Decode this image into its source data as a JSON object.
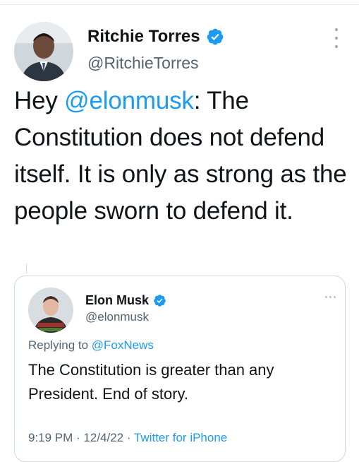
{
  "main_tweet": {
    "author_name": "Ritchie Torres",
    "author_handle": "@RitchieTorres",
    "text_prefix": "Hey ",
    "mention": "@elonmusk",
    "text_rest": ": The Constitution does not defend itself. It is only as strong as the people sworn to defend it.",
    "avatar_icon": "profile-photo",
    "verified_icon": "verified-badge-icon",
    "more_icon": "more-vertical-icon"
  },
  "quoted_tweet": {
    "author_name": "Elon Musk",
    "author_handle": "@elonmusk",
    "replying_prefix": "Replying to ",
    "replying_to": "@FoxNews",
    "text": "The Constitution is greater than any President. End of story.",
    "time": "9:19 PM",
    "separator": " · ",
    "date": "12/4/22",
    "source": "Twitter for iPhone",
    "more_icon": "more-horizontal-icon"
  },
  "colors": {
    "accent": "#1d9bf0",
    "secondary_text": "#536471",
    "primary_text": "#0f1419",
    "border": "#cfd9de"
  }
}
